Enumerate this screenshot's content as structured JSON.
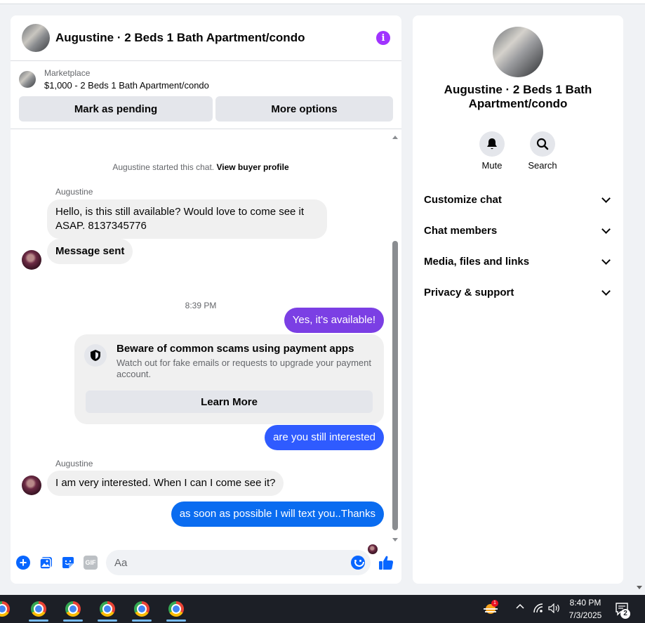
{
  "chat": {
    "title": "Augustine · 2 Beds 1 Bath Apartment/condo",
    "marketplace_label": "Marketplace",
    "listing": "$1,000 - 2 Beds 1 Bath Apartment/condo",
    "mark_pending": "Mark as pending",
    "more_options": "More options"
  },
  "messages": {
    "started_text": "Augustine started this chat.",
    "view_buyer": "View buyer profile",
    "sender1": "Augustine",
    "msg1": "Hello, is this still available? Would love to come see it ASAP. 8137345776",
    "msg2": "Message sent",
    "time": "8:39 PM",
    "msg3": "Yes, it's available!",
    "scam_title": "Beware of common scams using payment apps",
    "scam_text": "Watch out for fake emails or requests to upgrade your payment account.",
    "learn_more": "Learn More",
    "msg4": "are you still interested",
    "sender2": "Augustine",
    "msg5": "I am very interested. When I can I come see it?",
    "msg6": "as soon as possible I will text you..Thanks"
  },
  "composer": {
    "placeholder": "Aa",
    "gif": "GIF"
  },
  "right_panel": {
    "title": "Augustine · 2 Beds 1 Bath Apartment/condo",
    "mute": "Mute",
    "search": "Search",
    "sections": [
      "Customize chat",
      "Chat members",
      "Media, files and links",
      "Privacy & support"
    ]
  },
  "taskbar": {
    "time": "8:40 PM",
    "date": "7/3/2025",
    "notif_count": "1",
    "msg_count": "2"
  },
  "colors": {
    "accent": "#0866ff",
    "bubble_out": "#0a7cff",
    "bubble_purple": "#7b3fe4",
    "info": "#a033ff"
  }
}
